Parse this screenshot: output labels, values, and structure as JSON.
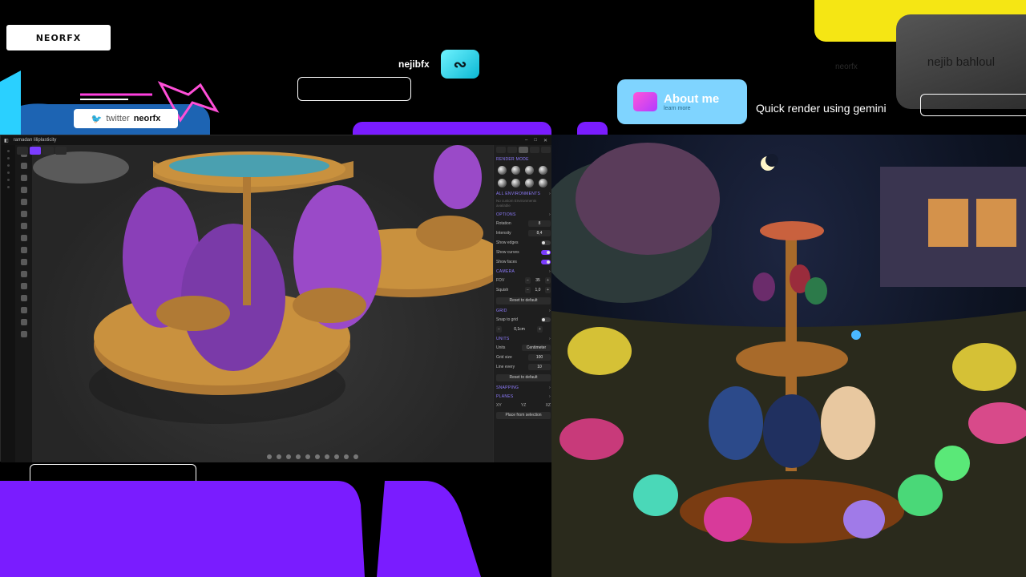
{
  "branding": {
    "logo_text": "NEORFX",
    "twitter_prefix": "twitter",
    "twitter_handle": "neorfx",
    "handle_text": "nejibfx",
    "about_title": "About me",
    "about_sub": "learn more",
    "caption": "Quick render using gemini",
    "author_name": "nejib bahloul",
    "faint_tag": "neorfx"
  },
  "app": {
    "window_title": "ramadan liliplasticity",
    "panel": {
      "render_mode_label": "RENDER MODE",
      "environments_label": "ALL ENVIRONMENTS",
      "environments_hint": "No custom Environments available",
      "options_label": "OPTIONS",
      "rotation_label": "Rotation",
      "rotation_value": "8",
      "intensity_label": "Intensity",
      "intensity_value": "8,4",
      "show_edges_label": "Show edges",
      "show_edges_on": false,
      "show_curves_label": "Show curves",
      "show_curves_on": true,
      "show_faces_label": "Show faces",
      "show_faces_on": true,
      "camera_label": "CAMERA",
      "fov_label": "FOV",
      "fov_value": "35",
      "squish_label": "Squish",
      "squish_value": "1,0",
      "reset_default_label": "Reset to default",
      "grid_label": "GRID",
      "snap_grid_label": "Snap to grid",
      "grid_size_value": "0,1cm",
      "units_label": "UNITS",
      "units_row_label": "Units",
      "units_value": "Centimeter",
      "grid_size_label": "Grid size",
      "grid_size_num": "100",
      "line_every_label": "Line every",
      "line_every_value": "10",
      "snapping_label": "SNAPPING",
      "planes_label": "PLANES",
      "plane_xy": "XY",
      "plane_yz": "YZ",
      "plane_xz": "XZ",
      "place_selection_label": "Place from selection"
    }
  },
  "colors": {
    "accent_purple": "#7a1cff",
    "accent_cyan": "#7fd4ff",
    "accent_yellow": "#f5e614",
    "gold": "#b8843a",
    "egg_purple": "#8a3fb8"
  },
  "icons": [
    "twitter-icon",
    "handle-logo-icon",
    "chevron-icon",
    "window-minimize-icon",
    "window-maximize-icon",
    "window-close-icon"
  ]
}
